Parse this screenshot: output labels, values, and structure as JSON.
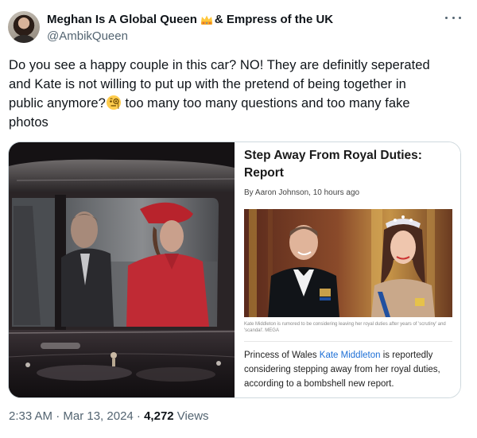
{
  "author": {
    "name_part1": "Meghan Is A Global Queen",
    "name_part2": "& Empress of the UK",
    "handle": "@AmbikQueen",
    "crown_emoji": "crown-emoji"
  },
  "tweet": {
    "line1": "Do you see a happy couple in this car? NO! They are definitly seperated",
    "line2": "and Kate is not willing to put up with the pretend of being together in",
    "line3a": "public anymore?",
    "line3b": " too many too many questions and too many fake",
    "line4": "photos",
    "emoji": "face-with-monocle-emoji"
  },
  "card": {
    "title": "Step Away From Royal Duties: Report",
    "byline": "By Aaron Johnson, 10 hours ago",
    "caption": "Kate Middleton is rumored to be considering leaving her royal duties after years of 'scrutiny' and 'scandal'. MEGA",
    "body_part1": "Princess of Wales ",
    "body_link": "Kate Middleton",
    "body_part2": " is reportedly considering stepping away from her royal duties, according to a bombshell new report."
  },
  "meta": {
    "time": "2:33 AM · Mar 13, 2024 · ",
    "views_count": "4,272",
    "views_label": " Views"
  },
  "colors": {
    "text": "#0f1419",
    "secondary": "#536471",
    "border": "#cfd9de",
    "link": "#1d6fd6"
  }
}
